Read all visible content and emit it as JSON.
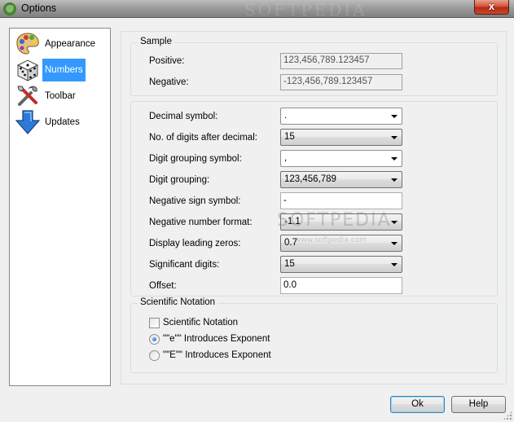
{
  "window": {
    "title": "Options",
    "close_glyph": "x",
    "bg_watermark": "SOFTPEDIA"
  },
  "sidebar": {
    "items": [
      {
        "label": "Appearance",
        "icon": "palette-icon",
        "selected": false
      },
      {
        "label": "Numbers",
        "icon": "dice-icon",
        "selected": true
      },
      {
        "label": "Toolbar",
        "icon": "tools-icon",
        "selected": false
      },
      {
        "label": "Updates",
        "icon": "download-arrow-icon",
        "selected": false
      }
    ]
  },
  "sample": {
    "title": "Sample",
    "positive_label": "Positive:",
    "positive_value": "123,456,789.123457",
    "negative_label": "Negative:",
    "negative_value": "-123,456,789.123457"
  },
  "settings": {
    "decimal_symbol": {
      "label": "Decimal symbol:",
      "value": "."
    },
    "digits_after_decimal": {
      "label": "No. of digits after decimal:",
      "value": "15"
    },
    "grouping_symbol": {
      "label": "Digit grouping symbol:",
      "value": ","
    },
    "digit_grouping": {
      "label": "Digit grouping:",
      "value": "123,456,789"
    },
    "negative_sign": {
      "label": "Negative sign symbol:",
      "value": "-"
    },
    "negative_format": {
      "label": "Negative number format:",
      "value": "-1.1"
    },
    "leading_zeros": {
      "label": "Display leading zeros:",
      "value": "0.7"
    },
    "significant_digits": {
      "label": "Significant digits:",
      "value": "15"
    },
    "offset": {
      "label": "Offset:",
      "value": "0.0"
    }
  },
  "scientific": {
    "title": "Scientific Notation",
    "checkbox_label": "Scientific Notation",
    "checkbox_checked": false,
    "radio_e_label": "\"\"e\"\" Introduces Exponent",
    "radio_E_label": "\"\"E\"\" Introduces Exponent",
    "selected": "e"
  },
  "buttons": {
    "ok": "Ok",
    "help": "Help"
  },
  "watermark": {
    "main": "SOFTPEDIA",
    "sub": "www.softpedia.com"
  }
}
